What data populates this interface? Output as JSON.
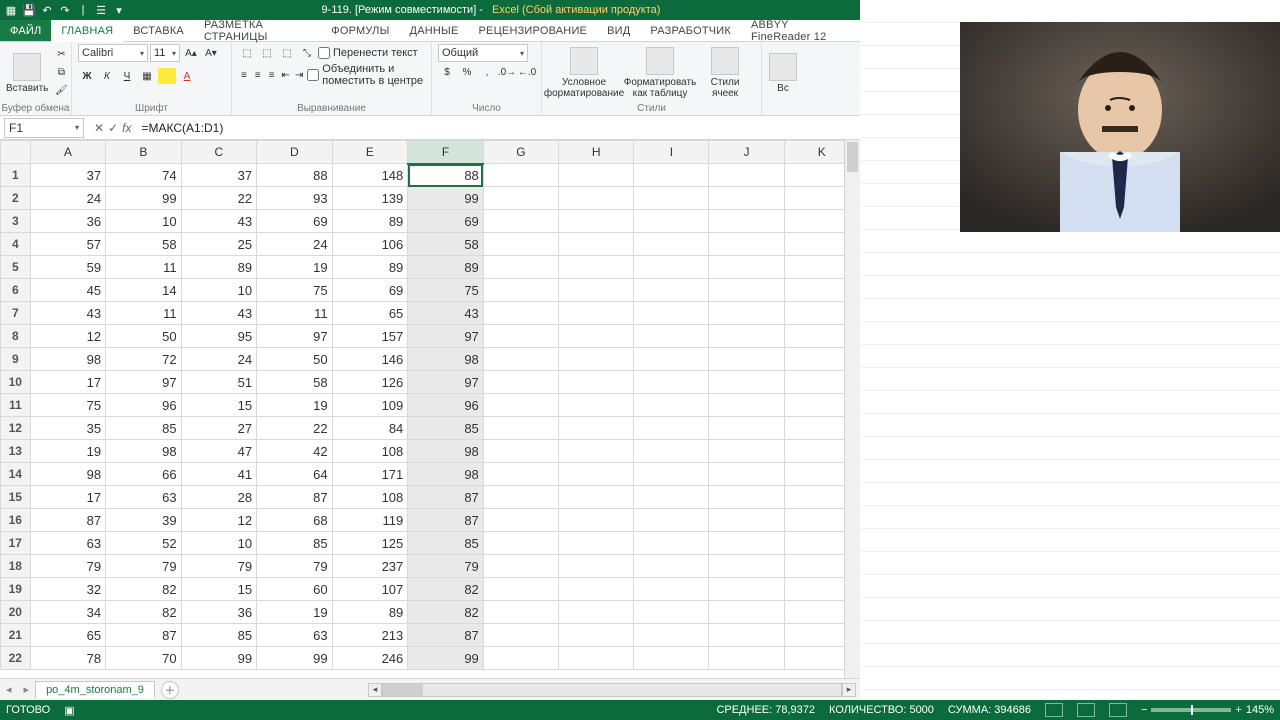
{
  "qat": {
    "docTitle": "9-119.  [Режим совместимости]  -",
    "appTitle": "Excel (Сбой активации продукта)"
  },
  "tabs": {
    "file": "ФАЙЛ",
    "items": [
      "ГЛАВНАЯ",
      "ВСТАВКА",
      "РАЗМЕТКА СТРАНИЦЫ",
      "ФОРМУЛЫ",
      "ДАННЫЕ",
      "РЕЦЕНЗИРОВАНИЕ",
      "ВИД",
      "РАЗРАБОТЧИК",
      "ABBYY FineReader 12"
    ],
    "activeIndex": 0
  },
  "ribbon": {
    "clipboard": {
      "paste": "Вставить",
      "label": "Буфер обмена"
    },
    "font": {
      "name": "Calibri",
      "size": "11",
      "label": "Шрифт",
      "bold": "Ж",
      "italic": "К",
      "underline": "Ч"
    },
    "align": {
      "wrap": "Перенести текст",
      "merge": "Объединить и поместить в центре",
      "label": "Выравнивание"
    },
    "number": {
      "format": "Общий",
      "label": "Число"
    },
    "styles": {
      "cond": "Условное форматирование",
      "fmt": "Форматировать как таблицу",
      "cell": "Стили ячеек",
      "label": "Стили"
    },
    "cellsCut": "Вс"
  },
  "fx": {
    "name": "F1",
    "formula": "=МАКС(A1:D1)",
    "fxLabel": "fx"
  },
  "columns": [
    "A",
    "B",
    "C",
    "D",
    "E",
    "F",
    "G",
    "H",
    "I",
    "J",
    "K"
  ],
  "selectedCol": 5,
  "activeCell": {
    "r": 0,
    "c": 5
  },
  "rows": [
    [
      37,
      74,
      37,
      88,
      148,
      88
    ],
    [
      24,
      99,
      22,
      93,
      139,
      99
    ],
    [
      36,
      10,
      43,
      69,
      89,
      69
    ],
    [
      57,
      58,
      25,
      24,
      106,
      58
    ],
    [
      59,
      11,
      89,
      19,
      89,
      89
    ],
    [
      45,
      14,
      10,
      75,
      69,
      75
    ],
    [
      43,
      11,
      43,
      11,
      65,
      43
    ],
    [
      12,
      50,
      95,
      97,
      157,
      97
    ],
    [
      98,
      72,
      24,
      50,
      146,
      98
    ],
    [
      17,
      97,
      51,
      58,
      126,
      97
    ],
    [
      75,
      96,
      15,
      19,
      109,
      96
    ],
    [
      35,
      85,
      27,
      22,
      84,
      85
    ],
    [
      19,
      98,
      47,
      42,
      108,
      98
    ],
    [
      98,
      66,
      41,
      64,
      171,
      98
    ],
    [
      17,
      63,
      28,
      87,
      108,
      87
    ],
    [
      87,
      39,
      12,
      68,
      119,
      87
    ],
    [
      63,
      52,
      10,
      85,
      125,
      85
    ],
    [
      79,
      79,
      79,
      79,
      237,
      79
    ],
    [
      32,
      82,
      15,
      60,
      107,
      82
    ],
    [
      34,
      82,
      36,
      19,
      89,
      82
    ],
    [
      65,
      87,
      85,
      63,
      213,
      87
    ],
    [
      78,
      70,
      99,
      99,
      246,
      99
    ]
  ],
  "sheetTab": {
    "name": "po_4m_storonam_9"
  },
  "status": {
    "ready": "ГОТОВО",
    "avg": "СРЕДНЕЕ: 78,9372",
    "count": "КОЛИЧЕСТВО: 5000",
    "sum": "СУММА: 394686",
    "zoom": "145%"
  }
}
